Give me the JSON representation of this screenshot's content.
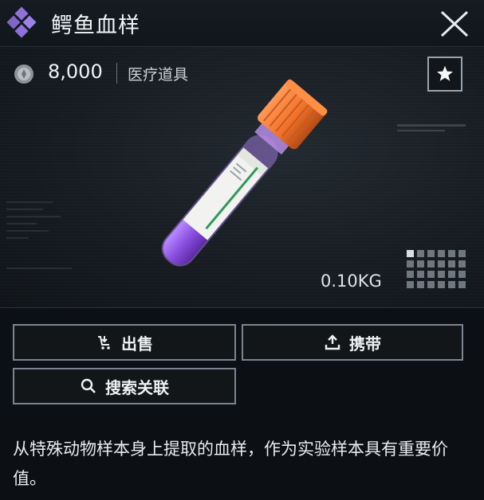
{
  "header": {
    "title": "鳄鱼血样"
  },
  "item": {
    "price": "8,000",
    "category": "医疗道具",
    "weight": "0.10KG"
  },
  "actions": {
    "sell": "出售",
    "carry": "携带",
    "search_related": "搜索关联"
  },
  "description": "从特殊动物样本身上提取的血样，作为实验样本具有重要价值。",
  "icons": [
    "diamond-logo-icon",
    "close-icon",
    "coin-icon",
    "star-icon",
    "sell-icon",
    "upload-icon",
    "search-icon"
  ],
  "colors": {
    "background": "#0c0f13",
    "cap": "#f2722a",
    "liquid": "#8a4fe0",
    "logo": "#8e72d9"
  }
}
